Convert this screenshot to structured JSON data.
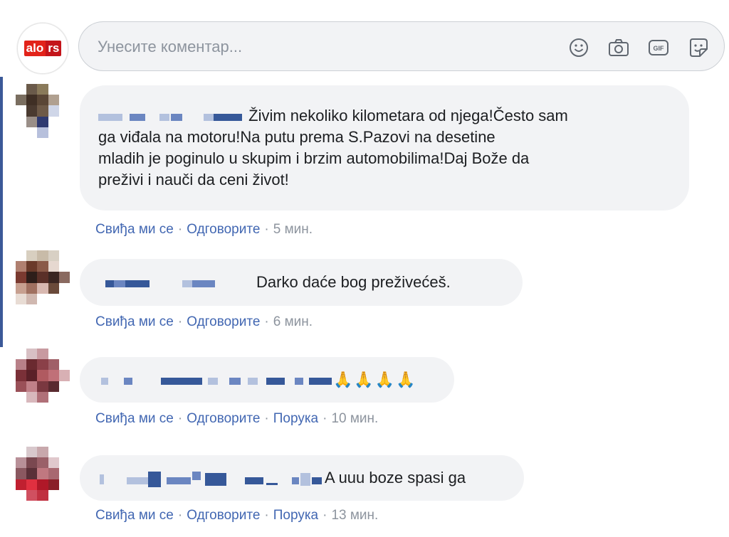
{
  "composer": {
    "placeholder": "Унесите коментар...",
    "logo_left": "alo",
    "logo_right": "rs",
    "icons": [
      "emoji-icon",
      "camera-icon",
      "gif-icon",
      "sticker-icon"
    ],
    "gif_label": "GIF"
  },
  "colors": {
    "bubble": "#f2f3f5",
    "link": "#4267b2",
    "meta": "#8d949e",
    "accent": "#3b5998",
    "logo_red": "#e2231a"
  },
  "comments": [
    {
      "text": "Živim nekoliko kilometara od njega!Često sam ga viđala na motoru!Na putu prema S.Pazovi na desetine mladih je poginulo u skupim i brzim automobilima!Daj Bože da preživi i nauči da ceni život!",
      "line1": "Živim nekoliko kilometara od njega!Često sam",
      "line2": "ga viđala na motoru!Na putu prema S.Pazovi na desetine",
      "line3": "mladih je poginulo u skupim i brzim automobilima!Daj Bože da",
      "line4": "preživi i nauči da ceni život!",
      "like": "Свиђа ми се",
      "reply": "Одговорите",
      "time": "5 мин."
    },
    {
      "text": "Darko daće bog preživećeš.",
      "like": "Свиђа ми се",
      "reply": "Одговорите",
      "time": "6 мин."
    },
    {
      "text": "🙏🙏🙏🙏",
      "like": "Свиђа ми се",
      "reply": "Одговорите",
      "message": "Порука",
      "time": "10 мин."
    },
    {
      "text": "A uuu boze spasi ga",
      "like": "Свиђа ми се",
      "reply": "Одговорите",
      "message": "Порука",
      "time": "13 мин."
    }
  ]
}
